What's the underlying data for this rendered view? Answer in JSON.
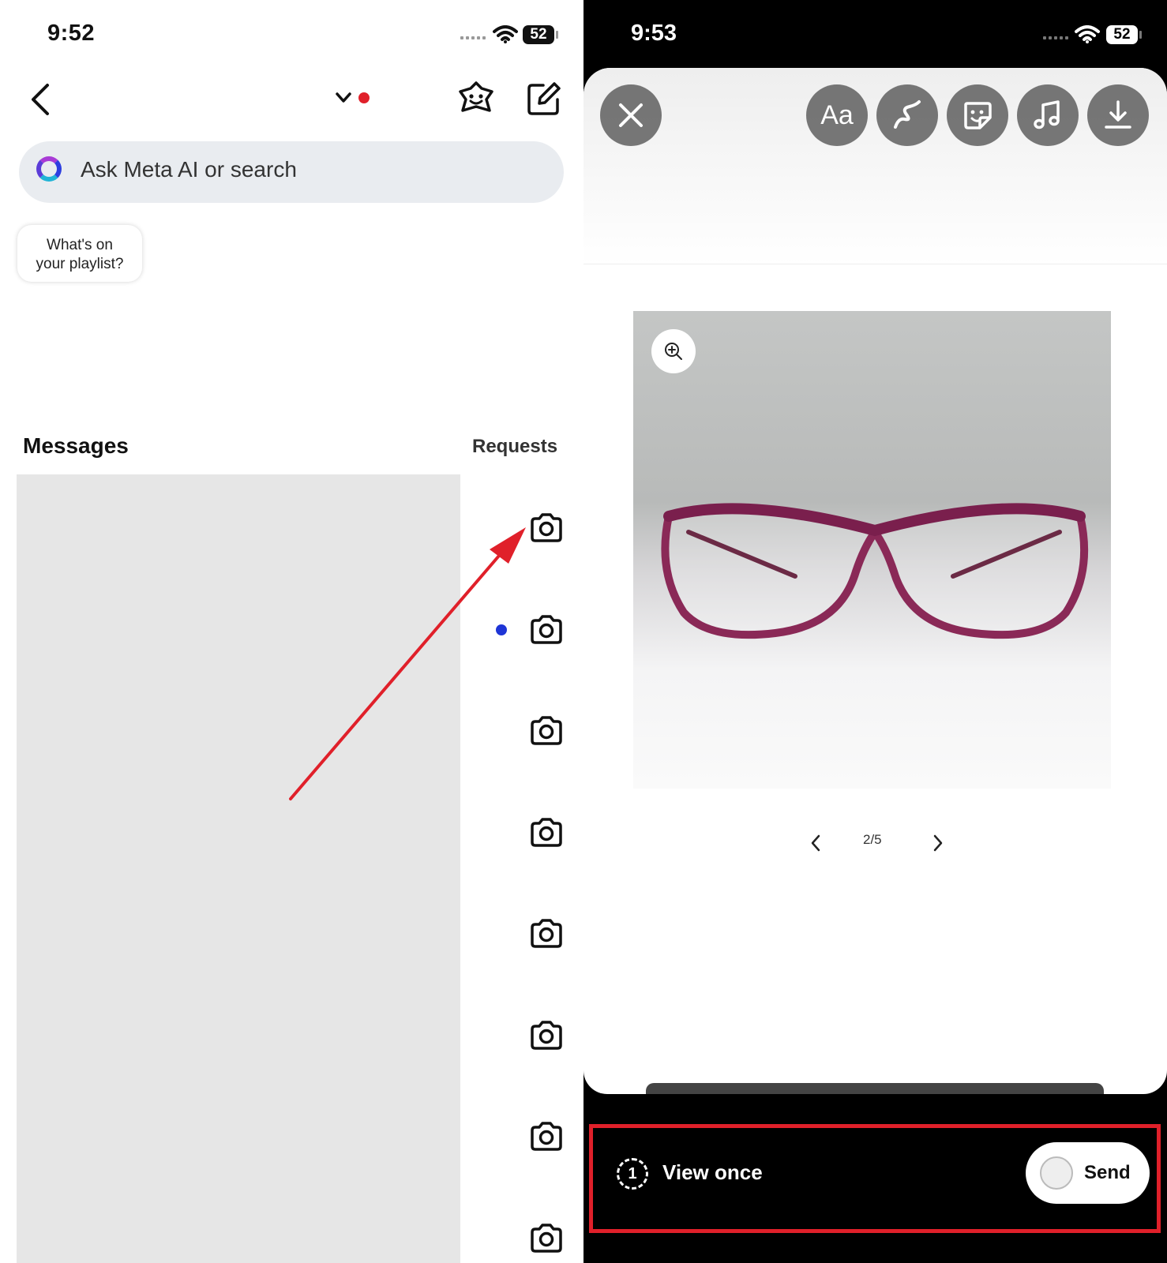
{
  "left_screen": {
    "status_bar": {
      "time": "9:52",
      "battery": "52"
    },
    "search": {
      "placeholder": "Ask Meta AI or search"
    },
    "note_bubble": {
      "line1": "What's on",
      "line2": "your playlist?"
    },
    "messages_title": "Messages",
    "requests_label": "Requests",
    "colors": {
      "notification_dot": "#e0202a",
      "unread_dot": "#1e35d6",
      "arrow": "#e0202a"
    }
  },
  "right_screen": {
    "status_bar": {
      "time": "9:53",
      "battery": "52"
    },
    "editor_tools": [
      "close-icon",
      "text-icon",
      "draw-icon",
      "sticker-icon",
      "music-icon",
      "download-icon"
    ],
    "text_tool_label": "Aa",
    "pager": {
      "label": "2/5"
    },
    "footer": {
      "view_once_count": "1",
      "view_once_label": "View once",
      "send_label": "Send",
      "highlight_color": "#e0202a"
    }
  }
}
